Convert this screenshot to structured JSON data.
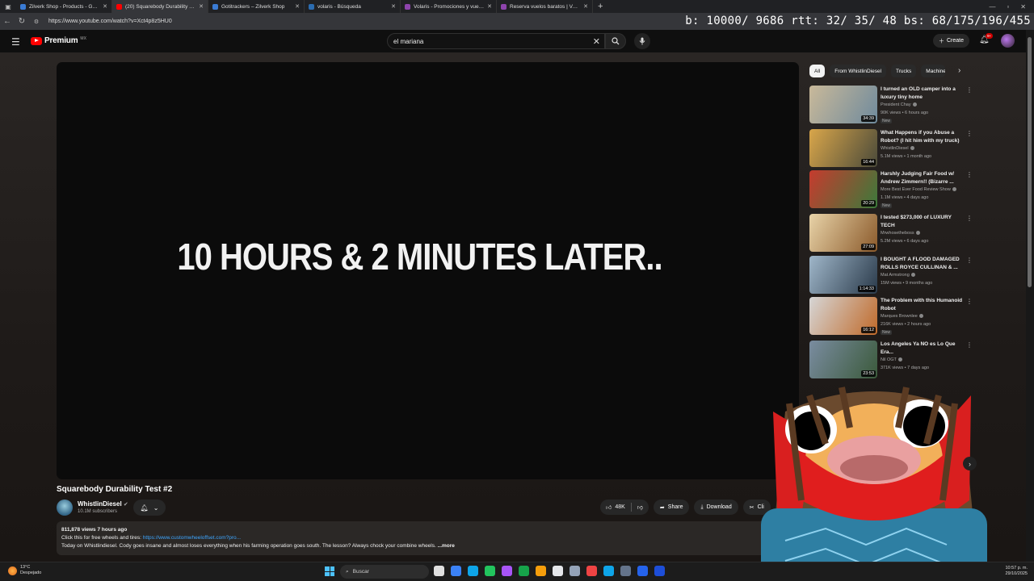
{
  "browser": {
    "tabs": [
      {
        "title": "Zilverk Shop - Products - Gotitrackers",
        "color": "#3a7bd5"
      },
      {
        "title": "(20) Squarebody Durability Test",
        "color": "#ff0000",
        "active": true
      },
      {
        "title": "Gotitrackers – Zilverk Shop",
        "color": "#3a7bd5"
      },
      {
        "title": "volaris - Búsqueda",
        "color": "#2b6cb0"
      },
      {
        "title": "Volaris - Promociones y vuelos m",
        "color": "#8e44ad"
      },
      {
        "title": "Reserva vuelos baratos | Volaris",
        "color": "#8e44ad"
      }
    ],
    "new_tab": "+",
    "url": "https://www.youtube.com/watch?v=Xct4p8z5HU0",
    "debug_overlay": "b: 10000/ 9686 rtt:  32/ 35/ 48 bs: 68/175/196/455"
  },
  "header": {
    "brand": "Premium",
    "region": "MX",
    "search_query": "el mariana",
    "create_label": "Create",
    "notif_count": "9+"
  },
  "player": {
    "overlay_text": "10 HOURS & 2 MINUTES LATER.."
  },
  "video": {
    "title": "Squarebody Durability Test #2",
    "channel": "WhistlinDiesel",
    "subscribers": "10.1M subscribers",
    "likes": "48K",
    "share_label": "Share",
    "download_label": "Download",
    "clip_label": "Cli",
    "description": {
      "stats": "811,878 views  7 hours ago",
      "line1_prefix": "Click this for free wheels and tires: ",
      "line1_link": "https://www.customwheeloffset.com?pro...",
      "line2": "Today on Whistlindiesel. Cody goes insane and almost loses everything when his farming operation goes south. The lesson? Always chock your combine wheels. ",
      "more": "...more"
    }
  },
  "sidebar": {
    "chips": [
      "All",
      "From WhistlinDiesel",
      "Trucks",
      "Machine"
    ],
    "recommendations": [
      {
        "title": "I turned an OLD camper into a luxury tiny home",
        "channel": "President Chay",
        "meta": "90K views • 6 hours ago",
        "duration": "34:39",
        "badge": "New",
        "thumb": [
          "#c9b99a",
          "#6f8a9c"
        ]
      },
      {
        "title": "What Happens if you Abuse a Robot? (I hit him with my truck)",
        "channel": "WhistlinDiesel",
        "meta": "5.1M views • 1 month ago",
        "duration": "16:44",
        "badge": "",
        "thumb": [
          "#d9a64a",
          "#4a4a3a"
        ]
      },
      {
        "title": "Harshly Judging Fair Food w/ Andrew Zimmern!! (Bizarre ...",
        "channel": "More Best Ever Food Review Show",
        "meta": "1.1M views • 4 days ago",
        "duration": "20:29",
        "badge": "New",
        "thumb": [
          "#c63b2e",
          "#3b7a3b"
        ]
      },
      {
        "title": "I tested $273,000 of LUXURY TECH",
        "channel": "Mrwhosetheboss",
        "meta": "5.2M views • 6 days ago",
        "duration": "27:09",
        "badge": "",
        "thumb": [
          "#e8d3a8",
          "#8b5a2b"
        ]
      },
      {
        "title": "I BOUGHT A FLOOD DAMAGED ROLLS ROYCE CULLINAN & ...",
        "channel": "Mat Armstrong",
        "meta": "15M views • 9 months ago",
        "duration": "1:14:33",
        "badge": "",
        "thumb": [
          "#9fb6c9",
          "#2a3a4a"
        ]
      },
      {
        "title": "The Problem with this Humanoid Robot",
        "channel": "Marques Brownlee",
        "meta": "216K views • 2 hours ago",
        "duration": "16:12",
        "badge": "New",
        "thumb": [
          "#d6d6d6",
          "#c06a2a"
        ]
      },
      {
        "title": "Los Angeles Ya NO es Lo Que Era...",
        "channel": "Nil OGT",
        "meta": "371K views • 7 days ago",
        "duration": "23:53",
        "badge": "",
        "thumb": [
          "#7a8ca0",
          "#3b5a3b"
        ]
      }
    ]
  },
  "taskbar": {
    "temperature": "13°C",
    "condition": "Despejado",
    "search_placeholder": "Buscar",
    "time": "10:57 p. m.",
    "date": "29/10/2025",
    "icon_colors": [
      "#e0e0e0",
      "#3b82f6",
      "#0ea5e9",
      "#22c55e",
      "#a855f7",
      "#16a34a",
      "#f59e0b",
      "#e5e7eb",
      "#94a3b8",
      "#ef4444",
      "#0ea5e9",
      "#64748b",
      "#2563eb",
      "#1d4ed8"
    ]
  }
}
